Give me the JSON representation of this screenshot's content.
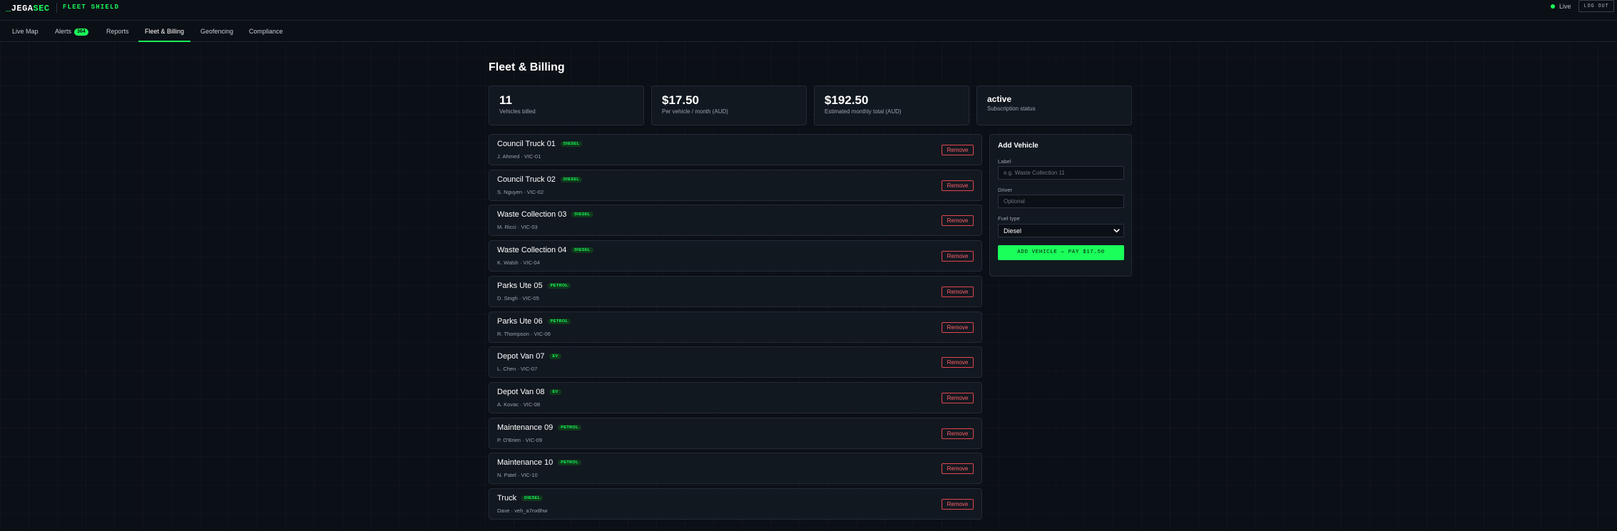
{
  "header": {
    "brand_underscore": "_",
    "brand_main": "JEGA",
    "brand_accent": "SEC",
    "product": "FLEET SHIELD",
    "live_label": "Live",
    "logout_label": "LOG OUT"
  },
  "nav": {
    "tabs": [
      {
        "label": "Live Map"
      },
      {
        "label": "Alerts",
        "badge": "364"
      },
      {
        "label": "Reports"
      },
      {
        "label": "Fleet & Billing",
        "active": true
      },
      {
        "label": "Geofencing"
      },
      {
        "label": "Compliance"
      }
    ]
  },
  "page": {
    "title": "Fleet & Billing"
  },
  "stats": [
    {
      "value": "11",
      "label": "Vehicles billed"
    },
    {
      "value": "$17.50",
      "label": "Per vehicle / month (AUD)"
    },
    {
      "value": "$192.50",
      "label": "Estimated monthly total (AUD)"
    },
    {
      "value": "active",
      "label": "Subscription status"
    }
  ],
  "vehicles": [
    {
      "name": "Council Truck 01",
      "fuel": "DIESEL",
      "subtitle": "J. Ahmed · VIC-01",
      "remove_label": "Remove"
    },
    {
      "name": "Council Truck 02",
      "fuel": "DIESEL",
      "subtitle": "S. Nguyen · VIC-02",
      "remove_label": "Remove"
    },
    {
      "name": "Waste Collection 03",
      "fuel": "DIESEL",
      "subtitle": "M. Ricci · VIC-03",
      "remove_label": "Remove"
    },
    {
      "name": "Waste Collection 04",
      "fuel": "DIESEL",
      "subtitle": "K. Walsh · VIC-04",
      "remove_label": "Remove"
    },
    {
      "name": "Parks Ute 05",
      "fuel": "PETROL",
      "subtitle": "D. Singh · VIC-05",
      "remove_label": "Remove"
    },
    {
      "name": "Parks Ute 06",
      "fuel": "PETROL",
      "subtitle": "R. Thompson · VIC-06",
      "remove_label": "Remove"
    },
    {
      "name": "Depot Van 07",
      "fuel": "EV",
      "subtitle": "L. Chen · VIC-07",
      "remove_label": "Remove"
    },
    {
      "name": "Depot Van 08",
      "fuel": "EV",
      "subtitle": "A. Kovac · VIC-08",
      "remove_label": "Remove"
    },
    {
      "name": "Maintenance 09",
      "fuel": "PETROL",
      "subtitle": "P. O'Brien · VIC-09",
      "remove_label": "Remove"
    },
    {
      "name": "Maintenance 10",
      "fuel": "PETROL",
      "subtitle": "N. Patel · VIC-10",
      "remove_label": "Remove"
    },
    {
      "name": "Truck",
      "fuel": "DIESEL",
      "subtitle": "Dave · veh_a7nx8hw",
      "remove_label": "Remove"
    }
  ],
  "add_vehicle": {
    "title": "Add Vehicle",
    "label_label": "Label",
    "label_placeholder": "e.g. Waste Collection 11",
    "label_value": "",
    "driver_label": "Driver",
    "driver_placeholder": "Optional",
    "driver_value": "",
    "fuel_label": "Fuel type",
    "fuel_value": "Diesel",
    "submit_label": "ADD VEHICLE — PAY $17.50"
  },
  "colors": {
    "accent": "#1aff5a",
    "danger": "#e0464e",
    "background": "#0b0f16",
    "card": "#121820"
  }
}
